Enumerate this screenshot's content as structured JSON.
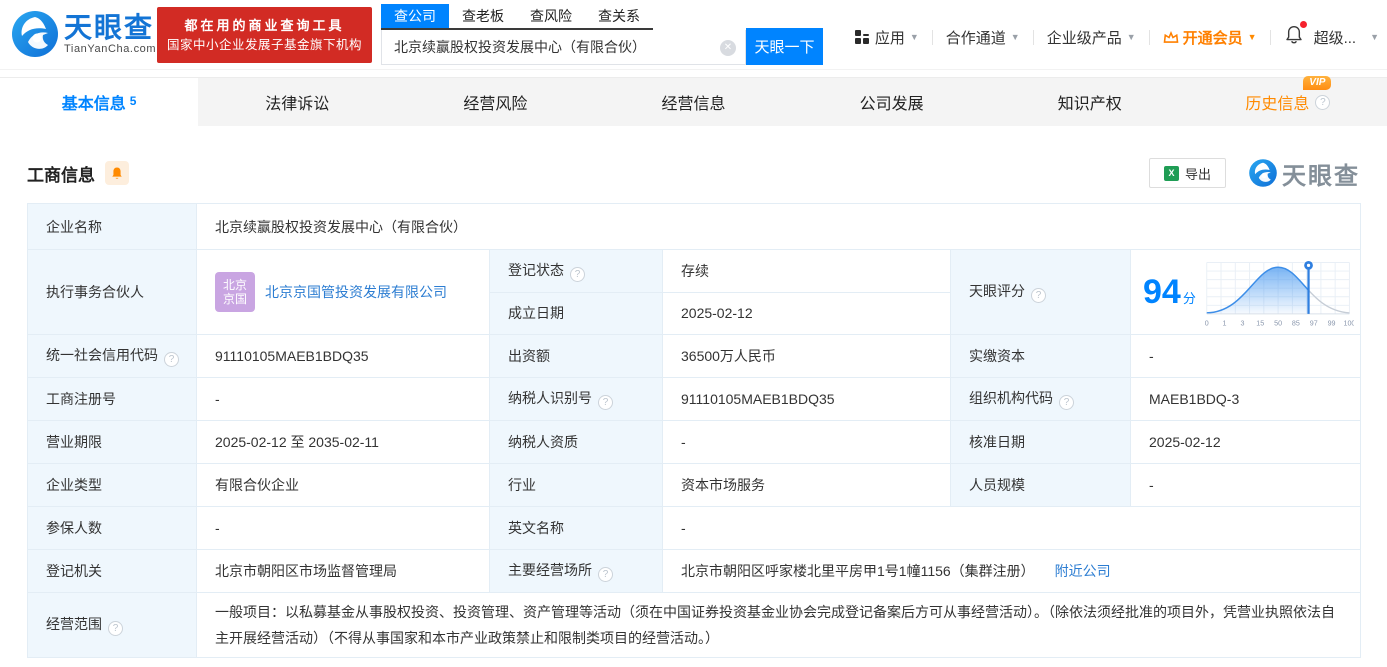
{
  "colors": {
    "accent_blue": "#0084ff",
    "status_green": "#0fbf5f",
    "vip_orange": "#ff8a00",
    "banner_red": "#d22b24",
    "avatar_purple": "#c9a5e2",
    "label_cell_bg": "#eff7fd"
  },
  "brand": {
    "name": "天眼查",
    "domain": "TianYanCha.com",
    "banner_line1": "都在用的商业查询工具",
    "banner_line2": "国家中小企业发展子基金旗下机构"
  },
  "search": {
    "tabs": [
      "查公司",
      "查老板",
      "查风险",
      "查关系"
    ],
    "value": "北京续赢股权投资发展中心（有限合伙）",
    "button_label": "天眼一下"
  },
  "top_menu": {
    "apps": "应用",
    "cooperation": "合作通道",
    "enterprise": "企业级产品",
    "vip": "开通会员",
    "super": "超级..."
  },
  "nav": {
    "tabs": [
      {
        "label": "基本信息",
        "badge": "5"
      },
      {
        "label": "法律诉讼"
      },
      {
        "label": "经营风险"
      },
      {
        "label": "经营信息"
      },
      {
        "label": "公司发展"
      },
      {
        "label": "知识产权"
      },
      {
        "label": "历史信息",
        "vip": "VIP"
      }
    ]
  },
  "section": {
    "title": "工商信息",
    "export_label": "导出",
    "logo_text": "天眼查"
  },
  "score": {
    "value": "94",
    "unit": "分",
    "axis_ticks": [
      "0",
      "1",
      "3",
      "15",
      "50",
      "85",
      "97",
      "99",
      "100"
    ]
  },
  "fields": {
    "company_name": {
      "label": "企业名称",
      "value": "北京续赢股权投资发展中心（有限合伙）"
    },
    "partner": {
      "label": "执行事务合伙人",
      "avatar_text": "北京京国",
      "value": "北京京国管投资发展有限公司"
    },
    "reg_status": {
      "label": "登记状态",
      "value": "存续"
    },
    "establish_date": {
      "label": "成立日期",
      "value": "2025-02-12"
    },
    "score": {
      "label": "天眼评分"
    },
    "credit_code": {
      "label": "统一社会信用代码",
      "value": "91110105MAEB1BDQ35"
    },
    "capital": {
      "label": "出资额",
      "value": "36500万人民币"
    },
    "paid_capital": {
      "label": "实缴资本",
      "value": "-"
    },
    "reg_number": {
      "label": "工商注册号",
      "value": "-"
    },
    "taxpayer_id": {
      "label": "纳税人识别号",
      "value": "91110105MAEB1BDQ35"
    },
    "org_code": {
      "label": "组织机构代码",
      "value": "MAEB1BDQ-3"
    },
    "business_term": {
      "label": "营业期限",
      "value": "2025-02-12 至 2035-02-11"
    },
    "taxpayer_quality": {
      "label": "纳税人资质",
      "value": "-"
    },
    "approval_date": {
      "label": "核准日期",
      "value": "2025-02-12"
    },
    "company_type": {
      "label": "企业类型",
      "value": "有限合伙企业"
    },
    "industry": {
      "label": "行业",
      "value": "资本市场服务"
    },
    "staff_size": {
      "label": "人员规模",
      "value": "-"
    },
    "insured_count": {
      "label": "参保人数",
      "value": "-"
    },
    "english_name": {
      "label": "英文名称",
      "value": "-"
    },
    "reg_authority": {
      "label": "登记机关",
      "value": "北京市朝阳区市场监督管理局"
    },
    "business_address": {
      "label": "主要经营场所",
      "value": "北京市朝阳区呼家楼北里平房甲1号1幢1156（集群注册）",
      "link": "附近公司"
    },
    "business_scope": {
      "label": "经营范围",
      "value": "一般项目：以私募基金从事股权投资、投资管理、资产管理等活动（须在中国证券投资基金业协会完成登记备案后方可从事经营活动）。（除依法须经批准的项目外，凭营业执照依法自主开展经营活动）（不得从事国家和本市产业政策禁止和限制类项目的经营活动。）"
    }
  }
}
